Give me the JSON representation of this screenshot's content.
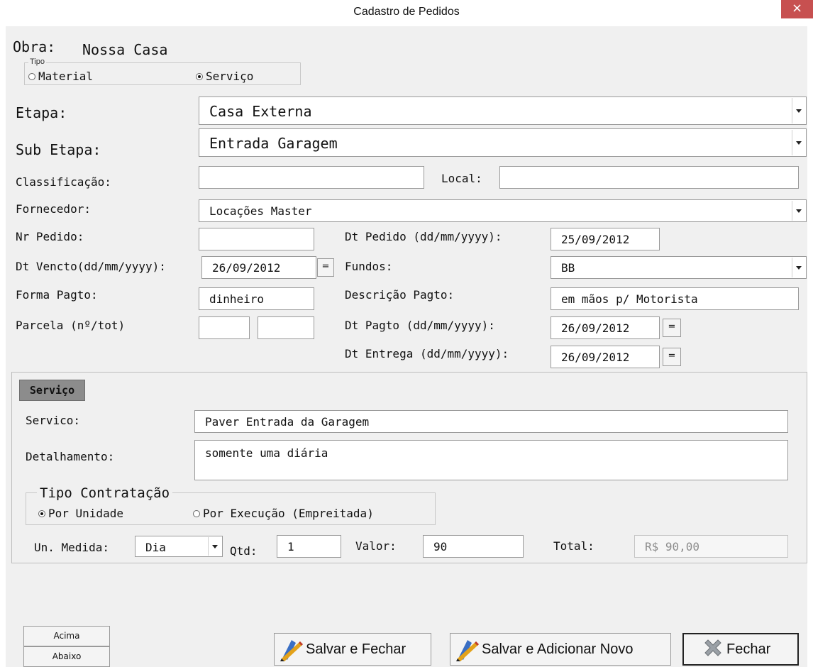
{
  "window": {
    "title": "Cadastro de Pedidos",
    "close_glyph": "×"
  },
  "obra": {
    "label": "Obra:",
    "value": "Nossa Casa"
  },
  "tipo": {
    "legend": "Tipo",
    "material_label": "Material",
    "servico_label": "Serviço",
    "selected": "Serviço"
  },
  "etapa": {
    "label": "Etapa:",
    "value": "Casa Externa"
  },
  "sub_etapa": {
    "label": "Sub Etapa:",
    "value": "Entrada Garagem"
  },
  "classificacao": {
    "label": "Classificação:",
    "value": ""
  },
  "local": {
    "label": "Local:",
    "value": ""
  },
  "fornecedor": {
    "label": "Fornecedor:",
    "value": "Locações Master"
  },
  "nr_pedido": {
    "label": "Nr Pedido:",
    "value": ""
  },
  "dt_pedido": {
    "label": "Dt Pedido (dd/mm/yyyy):",
    "value": "25/09/2012"
  },
  "dt_vencto": {
    "label": "Dt Vencto(dd/mm/yyyy):",
    "value": "26/09/2012",
    "btn": "="
  },
  "fundos": {
    "label": "Fundos:",
    "value": "BB"
  },
  "forma_pagto": {
    "label": "Forma Pagto:",
    "value": "dinheiro"
  },
  "descricao_pagto": {
    "label": "Descrição Pagto:",
    "value": "em mãos p/ Motorista"
  },
  "parcela": {
    "label": "Parcela  (nº/tot)",
    "numero": "",
    "total": ""
  },
  "dt_pagto": {
    "label": "Dt Pagto (dd/mm/yyyy):",
    "value": "26/09/2012",
    "btn": "="
  },
  "dt_entrega": {
    "label": "Dt Entrega (dd/mm/yyyy):",
    "value": "26/09/2012",
    "btn": "="
  },
  "servico_tab": {
    "tab_label": "Serviço",
    "servico": {
      "label": "Servico:",
      "value": "Paver Entrada da Garagem"
    },
    "detalhamento": {
      "label": "Detalhamento:",
      "value": "somente uma diária"
    },
    "tipo_contratacao": {
      "legend": "Tipo Contratação",
      "por_unidade": "Por Unidade",
      "por_execucao": "Por Execução (Empreitada)",
      "selected": "Por Unidade"
    },
    "un_medida": {
      "label": "Un. Medida:",
      "value": "Dia"
    },
    "qtd": {
      "label": "Qtd:",
      "value": "1"
    },
    "valor": {
      "label": "Valor:",
      "value": "90"
    },
    "total": {
      "label": "Total:",
      "value": "R$ 90,00"
    }
  },
  "buttons": {
    "acima": "Acima",
    "abaixo": "Abaixo",
    "salvar_fechar": "Salvar e Fechar",
    "salvar_novo": "Salvar e Adicionar Novo",
    "fechar": "Fechar"
  },
  "icons": {
    "save": "pencil-save-icon",
    "close": "x-close-icon",
    "dropdown": "chevron-down-icon"
  },
  "colors": {
    "tab_header": "#8c8c8c",
    "close_button": "#c75050",
    "window_bg": "#f0f0f0"
  }
}
